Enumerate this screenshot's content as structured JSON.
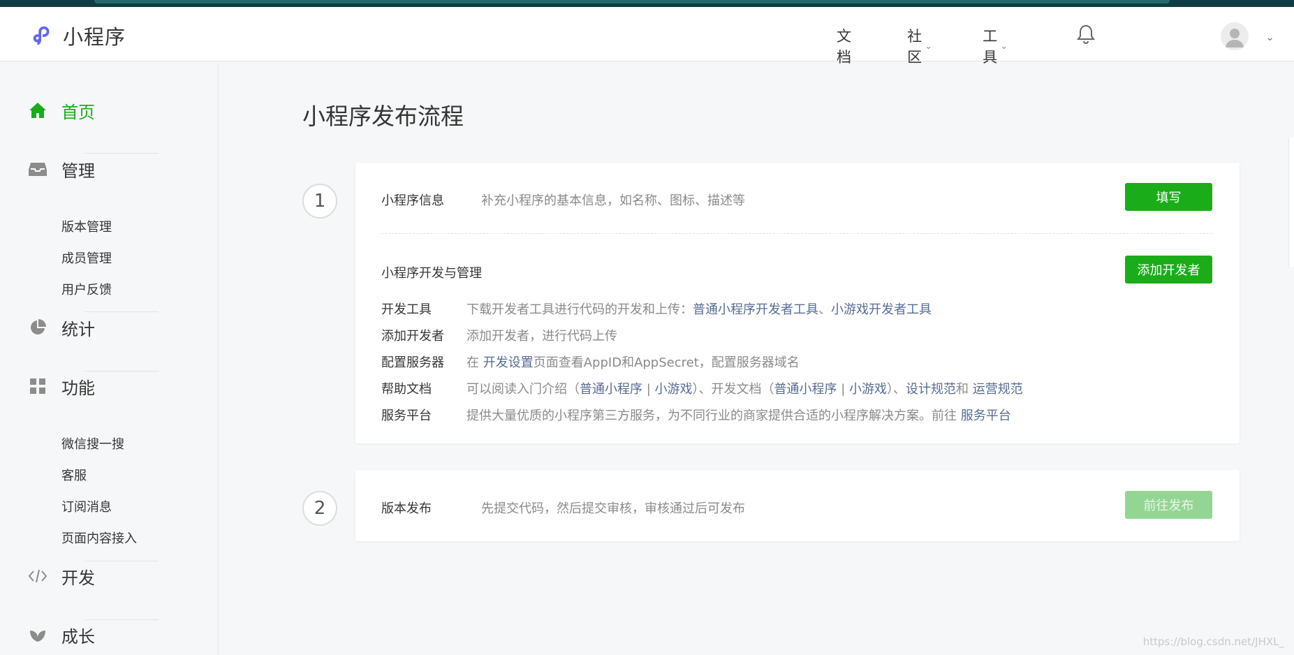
{
  "app": {
    "name": "小程序"
  },
  "topnav": {
    "docs": "文档",
    "community": "社区",
    "tools": "工具"
  },
  "sidebar": {
    "home": "首页",
    "manage": "管理",
    "manage_items": [
      "版本管理",
      "成员管理",
      "用户反馈"
    ],
    "stats": "统计",
    "features": "功能",
    "feature_items": [
      "微信搜一搜",
      "客服",
      "订阅消息",
      "页面内容接入"
    ],
    "dev": "开发",
    "growth": "成长"
  },
  "main": {
    "title": "小程序发布流程",
    "step1": {
      "number": "1",
      "info_label": "小程序信息",
      "info_desc": "补充小程序的基本信息，如名称、图标、描述等",
      "fill_button": "填写",
      "dev_title": "小程序开发与管理",
      "add_dev_button": "添加开发者",
      "rows": {
        "tools": {
          "key": "开发工具",
          "text": "下载开发者工具进行代码的开发和上传：",
          "link1": "普通小程序开发者工具",
          "sep": "、",
          "link2": "小游戏开发者工具"
        },
        "add_dev": {
          "key": "添加开发者",
          "text": "添加开发者，进行代码上传"
        },
        "server": {
          "key": "配置服务器",
          "pre": "在 ",
          "link": "开发设置",
          "post": "页面查看AppID和AppSecret，配置服务器域名"
        },
        "help": {
          "key": "帮助文档",
          "t1": "可以阅读入门介绍（",
          "l1": "普通小程序",
          "s1": " | ",
          "l2": "小游戏",
          "t2": "）、开发文档（",
          "l3": "普通小程序",
          "s2": " | ",
          "l4": "小游戏",
          "t3": "）、",
          "l5": "设计规范",
          "t4": "和 ",
          "l6": "运营规范"
        },
        "service": {
          "key": "服务平台",
          "text": "提供大量优质的小程序第三方服务，为不同行业的商家提供合适的小程序解决方案。前往 ",
          "link": "服务平台"
        }
      }
    },
    "step2": {
      "number": "2",
      "label": "版本发布",
      "desc": "先提交代码，然后提交审核，审核通过后可发布",
      "button": "前往发布"
    }
  },
  "watermark": "https://blog.csdn.net/JHXL_",
  "colors": {
    "accent": "#1aad19",
    "link": "#576b95",
    "brand": "#6467f0"
  }
}
